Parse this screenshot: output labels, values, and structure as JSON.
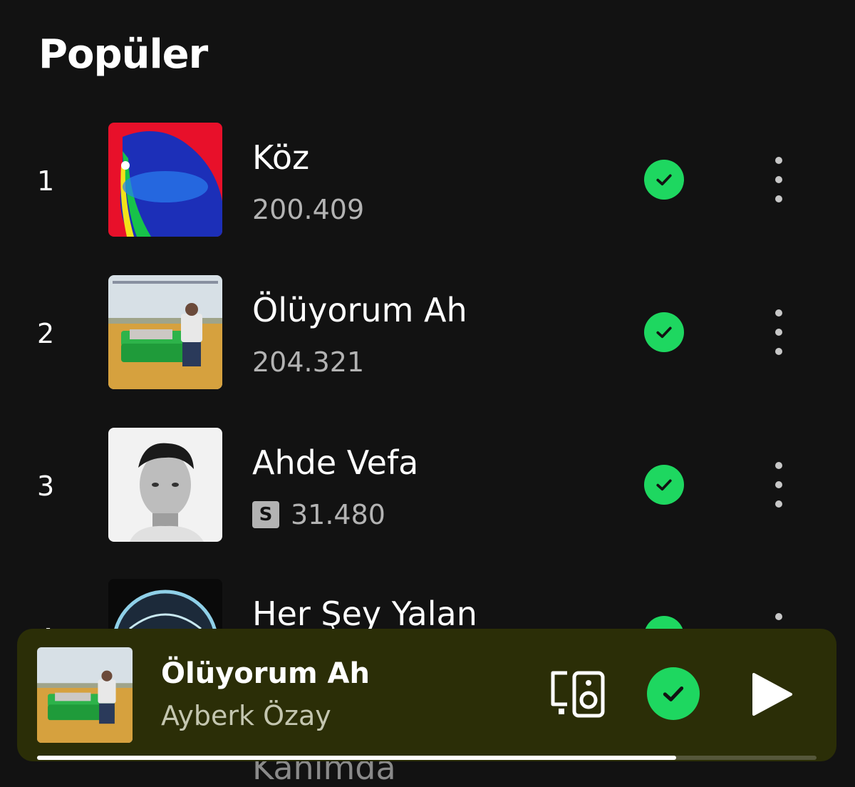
{
  "section": {
    "title": "Popüler"
  },
  "tracks": [
    {
      "rank": "1",
      "title": "Köz",
      "plays": "200.409",
      "explicit": false,
      "saved": true
    },
    {
      "rank": "2",
      "title": "Ölüyorum Ah",
      "plays": "204.321",
      "explicit": false,
      "saved": true
    },
    {
      "rank": "3",
      "title": "Ahde Vefa",
      "plays": "31.480",
      "explicit": true,
      "explicit_label": "S",
      "saved": true
    },
    {
      "rank": "4",
      "title": "Her Şey Yalan",
      "saved": true
    }
  ],
  "below_partial_text": "Kanımda",
  "now_playing": {
    "title": "Ölüyorum Ah",
    "artist": "Ayberk Özay",
    "saved": true,
    "progress_fraction": 0.82
  },
  "icons": {
    "saved": "check-circle-icon",
    "more": "more-vertical-icon",
    "device": "connect-device-icon",
    "play": "play-icon"
  },
  "colors": {
    "background": "#121212",
    "accent_green": "#1ed760",
    "secondary_text": "#b3b3b3",
    "mini_player_bg": "#2b2e07"
  }
}
